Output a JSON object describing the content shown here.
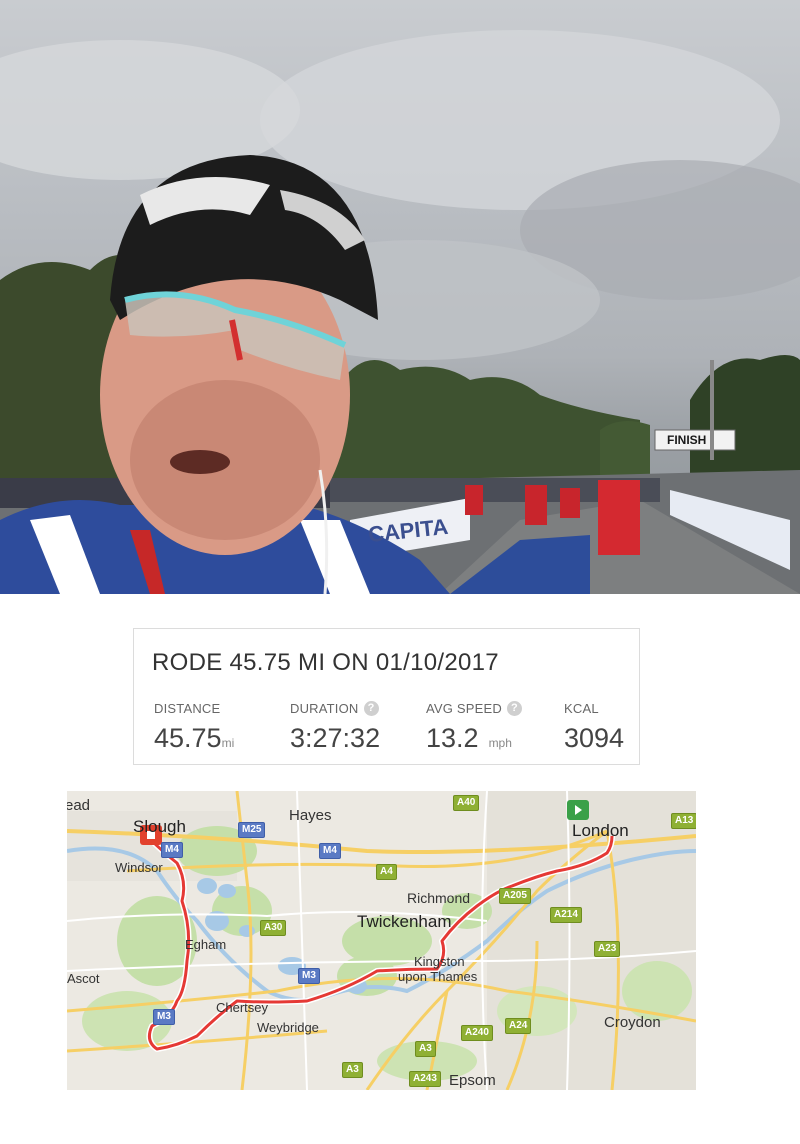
{
  "photo": {
    "finish_sign": "FINISH",
    "banner_text": "CAPITA"
  },
  "activity": {
    "title": "RODE 45.75 MI ON 01/10/2017",
    "stats": [
      {
        "label": "DISTANCE",
        "value": "45.75",
        "unit": "mi",
        "help": false
      },
      {
        "label": "DURATION",
        "value": "3:27:32",
        "unit": "",
        "help": true
      },
      {
        "label": "AVG SPEED",
        "value": "13.2",
        "unit": "mph",
        "help": true
      },
      {
        "label": "KCAL",
        "value": "3094",
        "unit": "",
        "help": false
      }
    ],
    "help_glyph": "?"
  },
  "map": {
    "places": {
      "ead": "ead",
      "slough": "Slough",
      "hayes": "Hayes",
      "london": "London",
      "windsor": "Windsor",
      "richmond": "Richmond",
      "twickenham": "Twickenham",
      "egham": "Egham",
      "ascot": "Ascot",
      "kingston1": "Kingston",
      "kingston2": "upon Thames",
      "chertsey": "Chertsey",
      "weybridge": "Weybridge",
      "croydon": "Croydon",
      "epsom": "Epsom"
    },
    "roads": {
      "a40": "A40",
      "a13": "A13",
      "m25": "M25",
      "m4a": "M4",
      "m4b": "M4",
      "a4": "A4",
      "a205": "A205",
      "a214": "A214",
      "a30": "A30",
      "a23": "A23",
      "m3a": "M3",
      "m3b": "M3",
      "a240": "A240",
      "a24": "A24",
      "a3a": "A3",
      "a3b": "A3",
      "a243": "A243"
    },
    "route_color": "#e53935",
    "start_icon": "play-icon",
    "end_icon": "stop-icon"
  }
}
